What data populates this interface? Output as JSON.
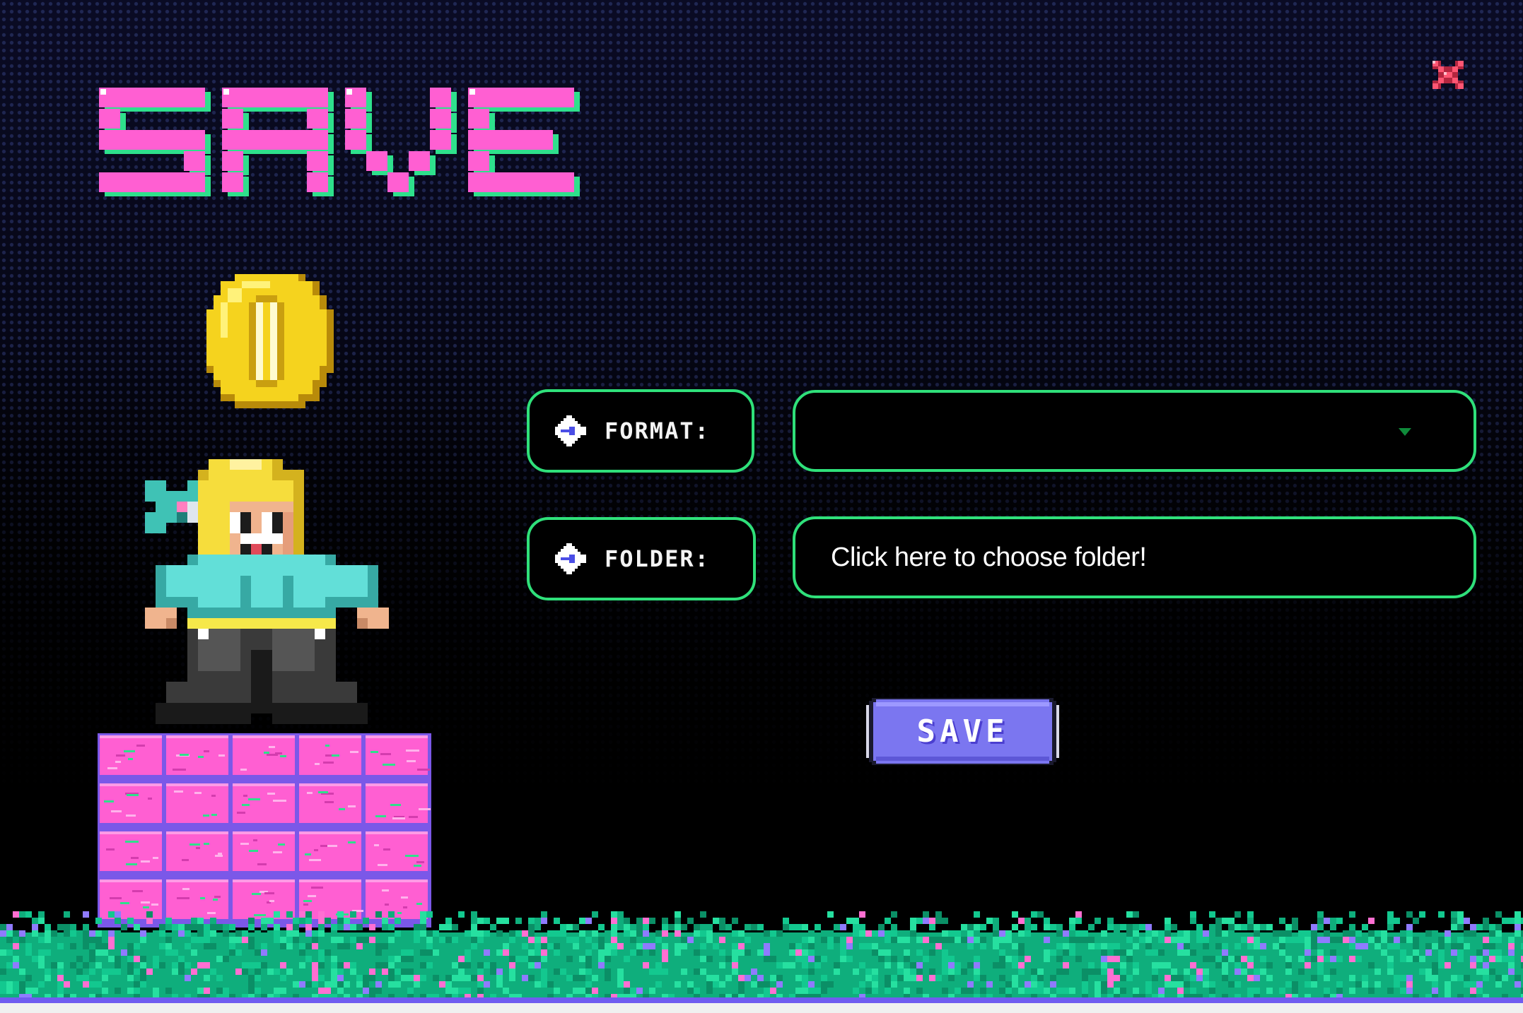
{
  "window": {
    "title": "SAVE",
    "close_icon": "close-x-icon"
  },
  "form": {
    "format_label": "FORMAT:",
    "format_value": "",
    "folder_label": "FOLDER:",
    "folder_placeholder": "Click here to choose folder!"
  },
  "actions": {
    "save_label": "SAVE"
  },
  "colors": {
    "title_pink": "#ff5fd2",
    "title_green": "#2ee08c",
    "field_border": "#2fe07a",
    "save_button": "#7b76f0",
    "close_red": "#ff4a6e"
  },
  "icons": {
    "field_marker": "arrow-right-icon",
    "dropdown": "dropdown-arrow-icon",
    "decor": [
      "coin-icon",
      "hero-character",
      "pink-brick-block",
      "pixel-grass"
    ]
  }
}
